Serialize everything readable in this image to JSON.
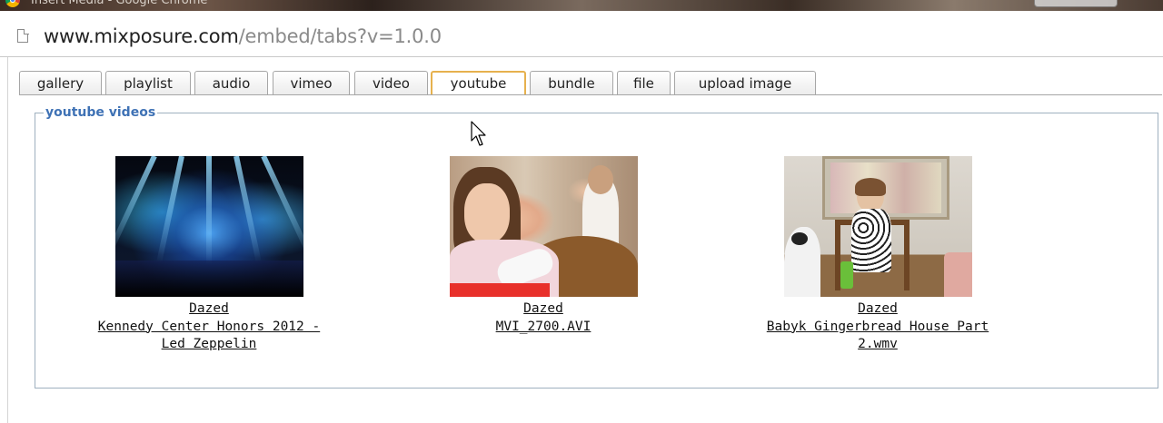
{
  "window": {
    "title": "Insert Media - Google Chrome"
  },
  "address_bar": {
    "url_host": "www.mixposure.com",
    "url_path": "/embed/tabs?v=1.0.0"
  },
  "tabs": [
    {
      "label": "gallery"
    },
    {
      "label": "playlist"
    },
    {
      "label": "audio"
    },
    {
      "label": "vimeo"
    },
    {
      "label": "video"
    },
    {
      "label": "youtube",
      "active": true
    },
    {
      "label": "bundle"
    },
    {
      "label": "file"
    },
    {
      "label": "upload image"
    }
  ],
  "panel": {
    "legend": "youtube videos"
  },
  "videos": [
    {
      "line1": "Dazed",
      "line2": "Kennedy Center Honors 2012 -",
      "line3": "Led Zeppelin",
      "thumbnail": "concert-stage-image"
    },
    {
      "line1": "Dazed",
      "line2": "MVI_2700.AVI",
      "line3": "",
      "thumbnail": "child-with-cast-image"
    },
    {
      "line1": "Dazed",
      "line2": "Babyk Gingerbread House Part",
      "line3": "2.wmv",
      "thumbnail": "child-in-chair-image"
    }
  ],
  "colors": {
    "active_tab_border": "#e6b14e",
    "legend_text": "#3f72b5",
    "fieldset_border": "#9fb0bf"
  }
}
